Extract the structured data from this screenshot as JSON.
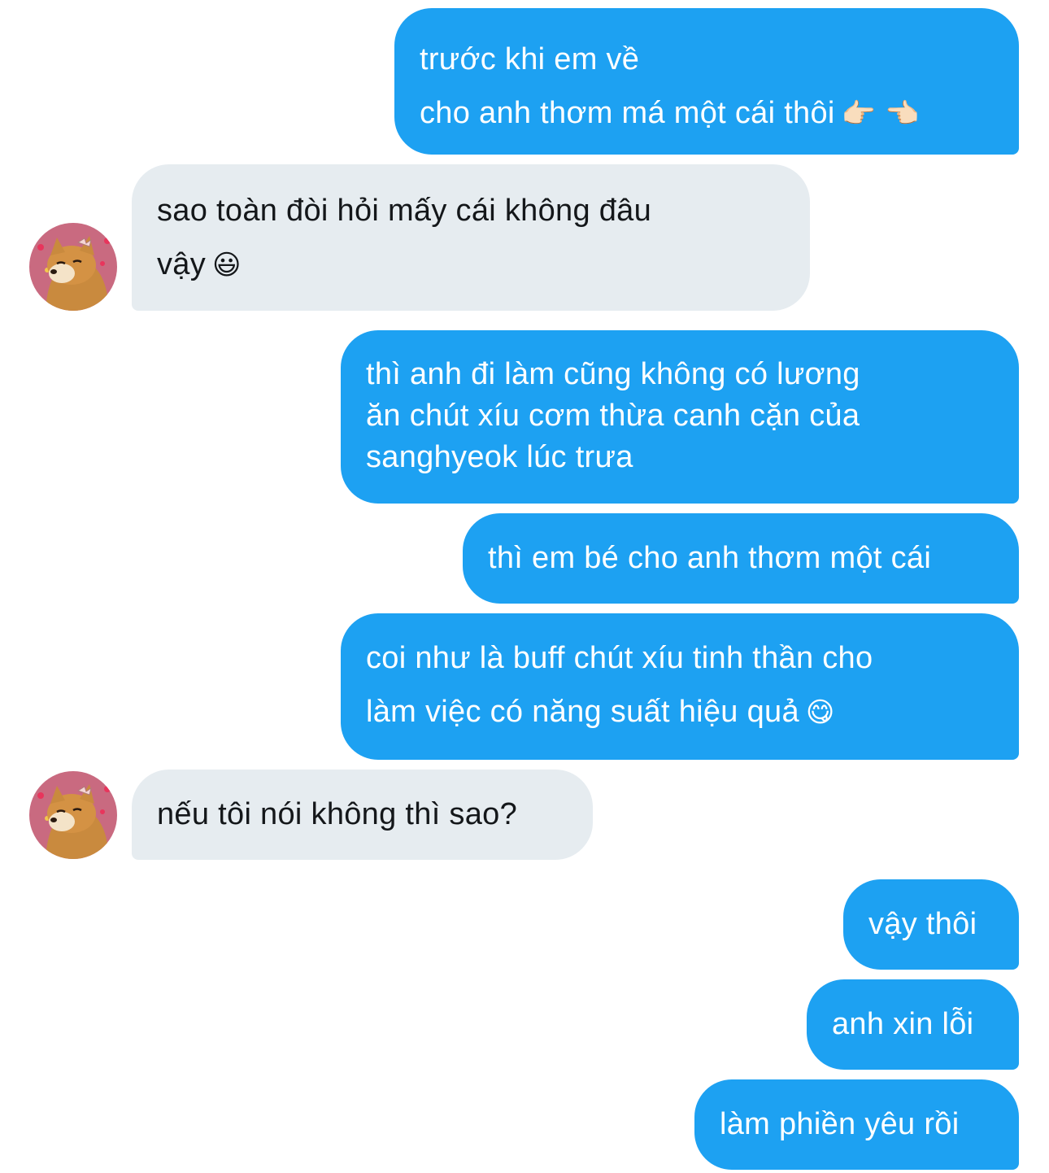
{
  "colors": {
    "sent_bubble": "#1da1f2",
    "received_bubble": "#e6ecf0",
    "sent_text": "#ffffff",
    "received_text": "#14171a",
    "avatar_bg": "#c96a80"
  },
  "messages": [
    {
      "sender": "me",
      "lines": [
        "trước khi em về",
        "cho anh thơm má một cái thôi"
      ],
      "emoji": "👉🏻 👈🏻"
    },
    {
      "sender": "them",
      "lines": [
        "sao toàn đòi hỏi mấy cái không đâu",
        "vậy"
      ],
      "emoji": "😃"
    },
    {
      "sender": "me",
      "lines": [
        "thì anh đi làm cũng không có lương",
        "ăn chút xíu cơm thừa canh cặn của",
        "sanghyeok lúc trưa"
      ]
    },
    {
      "sender": "me",
      "lines": [
        "thì em bé cho anh thơm một cái"
      ]
    },
    {
      "sender": "me",
      "lines": [
        "coi như là buff chút xíu tinh thần cho",
        "làm việc có năng suất hiệu quả"
      ],
      "emoji": "😋"
    },
    {
      "sender": "them",
      "lines": [
        "nếu tôi nói không thì sao?"
      ]
    },
    {
      "sender": "me",
      "lines": [
        "vậy thôi"
      ]
    },
    {
      "sender": "me",
      "lines": [
        "anh xin lỗi"
      ]
    },
    {
      "sender": "me",
      "lines": [
        "làm phiền yêu rồi"
      ]
    }
  ]
}
